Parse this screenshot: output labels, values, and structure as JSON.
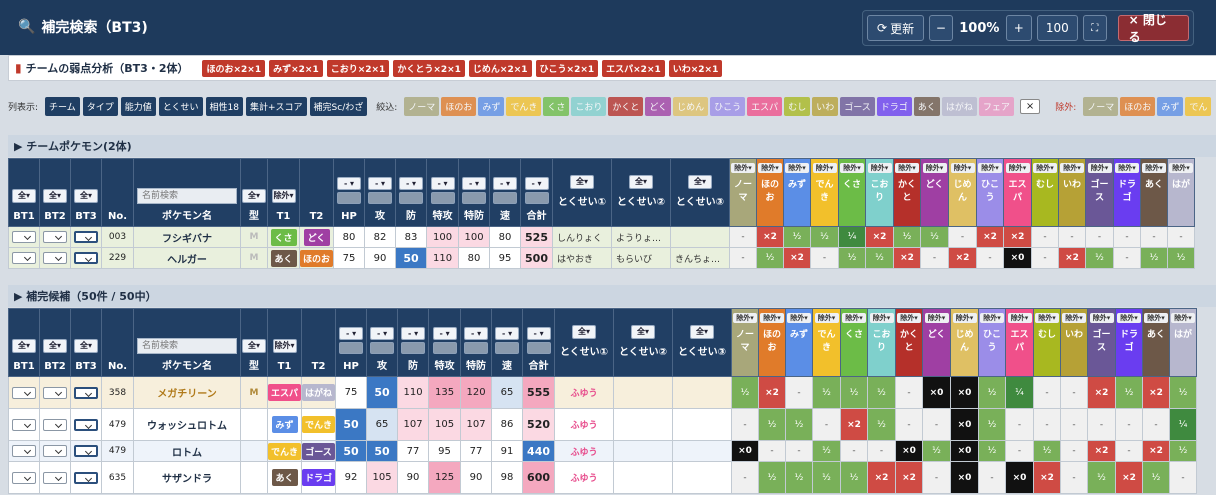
{
  "window": {
    "title": "補完検索（BT3)",
    "refresh_label": "更新",
    "minus": "−",
    "zoom": "100%",
    "plus": "+",
    "count": "100",
    "close_label": "× 閉じる"
  },
  "weakness": {
    "title": "チームの弱点分析（BT3・2体）",
    "tags": [
      "ほのお×2×1",
      "みず×2×1",
      "こおり×2×1",
      "かくとう×2×1",
      "じめん×2×1",
      "ひこう×2×1",
      "エスパ×2×1",
      "いわ×2×1"
    ]
  },
  "filter": {
    "cols_label": "列表示:",
    "col_buttons": [
      "チーム",
      "タイプ",
      "能力値",
      "とくせい",
      "相性18",
      "集計+スコア",
      "補完Sc/わざ"
    ],
    "narrow_label": "絞込:",
    "narrow_types": [
      "ノーマ",
      "ほのお",
      "みず",
      "でんき",
      "くさ",
      "こおり",
      "かくと",
      "どく",
      "じめん",
      "ひこう",
      "エスパ",
      "むし",
      "いわ",
      "ゴース",
      "ドラゴ",
      "あく",
      "はがね",
      "フェア"
    ],
    "clear": "×",
    "exclude_label": "除外:",
    "exclude_types": [
      "ノーマ",
      "ほのお",
      "みず",
      "でん"
    ]
  },
  "colors": {
    "ノーマ": "#a8a77a",
    "ほのお": "#e07b2a",
    "みず": "#5b8ee6",
    "でんき": "#f2c02b",
    "くさ": "#6cbc47",
    "こおり": "#7fd0cc",
    "かくと": "#b5302a",
    "どく": "#9f3fa3",
    "じめん": "#dfc064",
    "ひこう": "#9b8de8",
    "エスパ": "#f0508a",
    "むし": "#a8b820",
    "いわ": "#b6a136",
    "ゴース": "#6a5797",
    "ドラゴ": "#6a3df0",
    "あく": "#6d5848",
    "はがね": "#b7b7ce",
    "フェア": "#e995c2"
  },
  "section_team": "▶ チームポケモン(2体)",
  "section_cand": "▶ 補完候補（50件 / 50中）",
  "headers": {
    "all": "全▾",
    "exclude": "除外▾",
    "filter": "- ▾",
    "bt1": "BT1",
    "bt2": "BT2",
    "bt3": "BT3",
    "no": "No.",
    "search_placeholder": "名前検索",
    "name": "ポケモン名",
    "mega": "型",
    "t1": "T1",
    "t2": "T2",
    "hp": "HP",
    "atk": "攻",
    "def": "防",
    "spa": "特攻",
    "spd": "特防",
    "spe": "速",
    "total": "合計",
    "total_sorted": "合計▼",
    "ab1": "とくせい①",
    "ab2": "とくせい②",
    "ab3": "とくせい③"
  },
  "type_cols": [
    "ノーマ",
    "ほのお",
    "みず",
    "でんき",
    "くさ",
    "こおり",
    "かくと",
    "どく",
    "じめん",
    "ひこう",
    "エスパ",
    "むし",
    "いわ",
    "ゴース",
    "ドラゴ",
    "あく",
    "はが"
  ],
  "team": [
    {
      "no": "003",
      "name": "フシギバナ",
      "mega": "M",
      "t1": "くさ",
      "t2": "どく",
      "hp": "80",
      "atk": "82",
      "def": "83",
      "spa": "100",
      "spd": "100",
      "spe": "80",
      "total": "525",
      "ab1": "しんりょく",
      "ab2": "ようりょ…",
      "ab3": "",
      "eff": [
        "-",
        "×2",
        "½",
        "½",
        "¼",
        "×2",
        "½",
        "½",
        "-",
        "×2",
        "×2",
        "-",
        "-",
        "-",
        "-",
        "-",
        "-"
      ]
    },
    {
      "no": "229",
      "name": "ヘルガー",
      "mega": "M",
      "t1": "あく",
      "t2": "ほのお",
      "hp": "75",
      "atk": "90",
      "def": "50",
      "spa": "110",
      "spd": "80",
      "spe": "95",
      "total": "500",
      "ab1": "はやおき",
      "ab2": "もらいび",
      "ab3": "きんちょ…",
      "eff": [
        "-",
        "½",
        "×2",
        "-",
        "½",
        "½",
        "×2",
        "-",
        "×2",
        "-",
        "×0",
        "-",
        "×2",
        "½",
        "-",
        "½",
        "½"
      ]
    }
  ],
  "cand": [
    {
      "no": "358",
      "name": "メガチリーン",
      "mega": "M",
      "t1": "エスパ",
      "t2": "はがね",
      "hp": "75",
      "atk": "50",
      "def": "110",
      "spa": "135",
      "spd": "120",
      "spe": "65",
      "total": "555",
      "ab1": "ふゆう",
      "eff": [
        "½",
        "×2",
        "-",
        "½",
        "½",
        "½",
        "-",
        "×0",
        "×0",
        "½",
        "¼",
        "-",
        "-",
        "×2",
        "½",
        "×2",
        "½"
      ]
    },
    {
      "no": "479",
      "name": "ウォッシュロトム",
      "mega": "",
      "t1": "みず",
      "t2": "でんき",
      "hp": "50",
      "atk": "65",
      "def": "107",
      "spa": "105",
      "spd": "107",
      "spe": "86",
      "total": "520",
      "ab1": "ふゆう",
      "eff": [
        "-",
        "½",
        "½",
        "-",
        "×2",
        "½",
        "-",
        "-",
        "×0",
        "½",
        "-",
        "-",
        "-",
        "-",
        "-",
        "-",
        "¼"
      ]
    },
    {
      "no": "479",
      "name": "ロトム",
      "mega": "",
      "t1": "でんき",
      "t2": "ゴース",
      "hp": "50",
      "atk": "50",
      "def": "77",
      "spa": "95",
      "spd": "77",
      "spe": "91",
      "total": "440",
      "ab1": "ふゆう",
      "eff": [
        "×0",
        "-",
        "-",
        "½",
        "-",
        "-",
        "×0",
        "½",
        "×0",
        "½",
        "-",
        "½",
        "-",
        "×2",
        "-",
        "×2",
        "½"
      ]
    },
    {
      "no": "635",
      "name": "サザンドラ",
      "mega": "",
      "t1": "あく",
      "t2": "ドラゴ",
      "hp": "92",
      "atk": "105",
      "def": "90",
      "spa": "125",
      "spd": "90",
      "spe": "98",
      "total": "600",
      "ab1": "ふゆう",
      "eff": [
        "-",
        "½",
        "½",
        "½",
        "½",
        "×2",
        "×2",
        "-",
        "×0",
        "-",
        "×0",
        "×2",
        "-",
        "½",
        "×2",
        "½",
        "-"
      ]
    }
  ]
}
